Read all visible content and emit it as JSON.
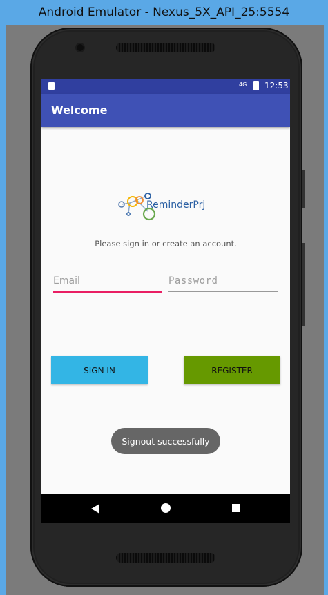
{
  "window": {
    "title": "Android Emulator - Nexus_5X_API_25:5554"
  },
  "status_bar": {
    "time": "12:53",
    "network": "4G"
  },
  "app_bar": {
    "title": "Welcome"
  },
  "logo": {
    "text": "ReminderPrj"
  },
  "form": {
    "subtitle": "Please sign in or create an account.",
    "email_placeholder": "Email",
    "password_placeholder": "Password"
  },
  "buttons": {
    "sign_in": "SIGN IN",
    "register": "REGISTER"
  },
  "toast": {
    "message": "Signout successfully"
  },
  "colors": {
    "status_bar": "#303f9f",
    "app_bar": "#3f51b5",
    "sign_in_button": "#33b5e5",
    "register_button": "#669900",
    "email_underline": "#e91e63"
  },
  "nav": {
    "back": "back-icon",
    "home": "home-icon",
    "recents": "recents-icon"
  }
}
